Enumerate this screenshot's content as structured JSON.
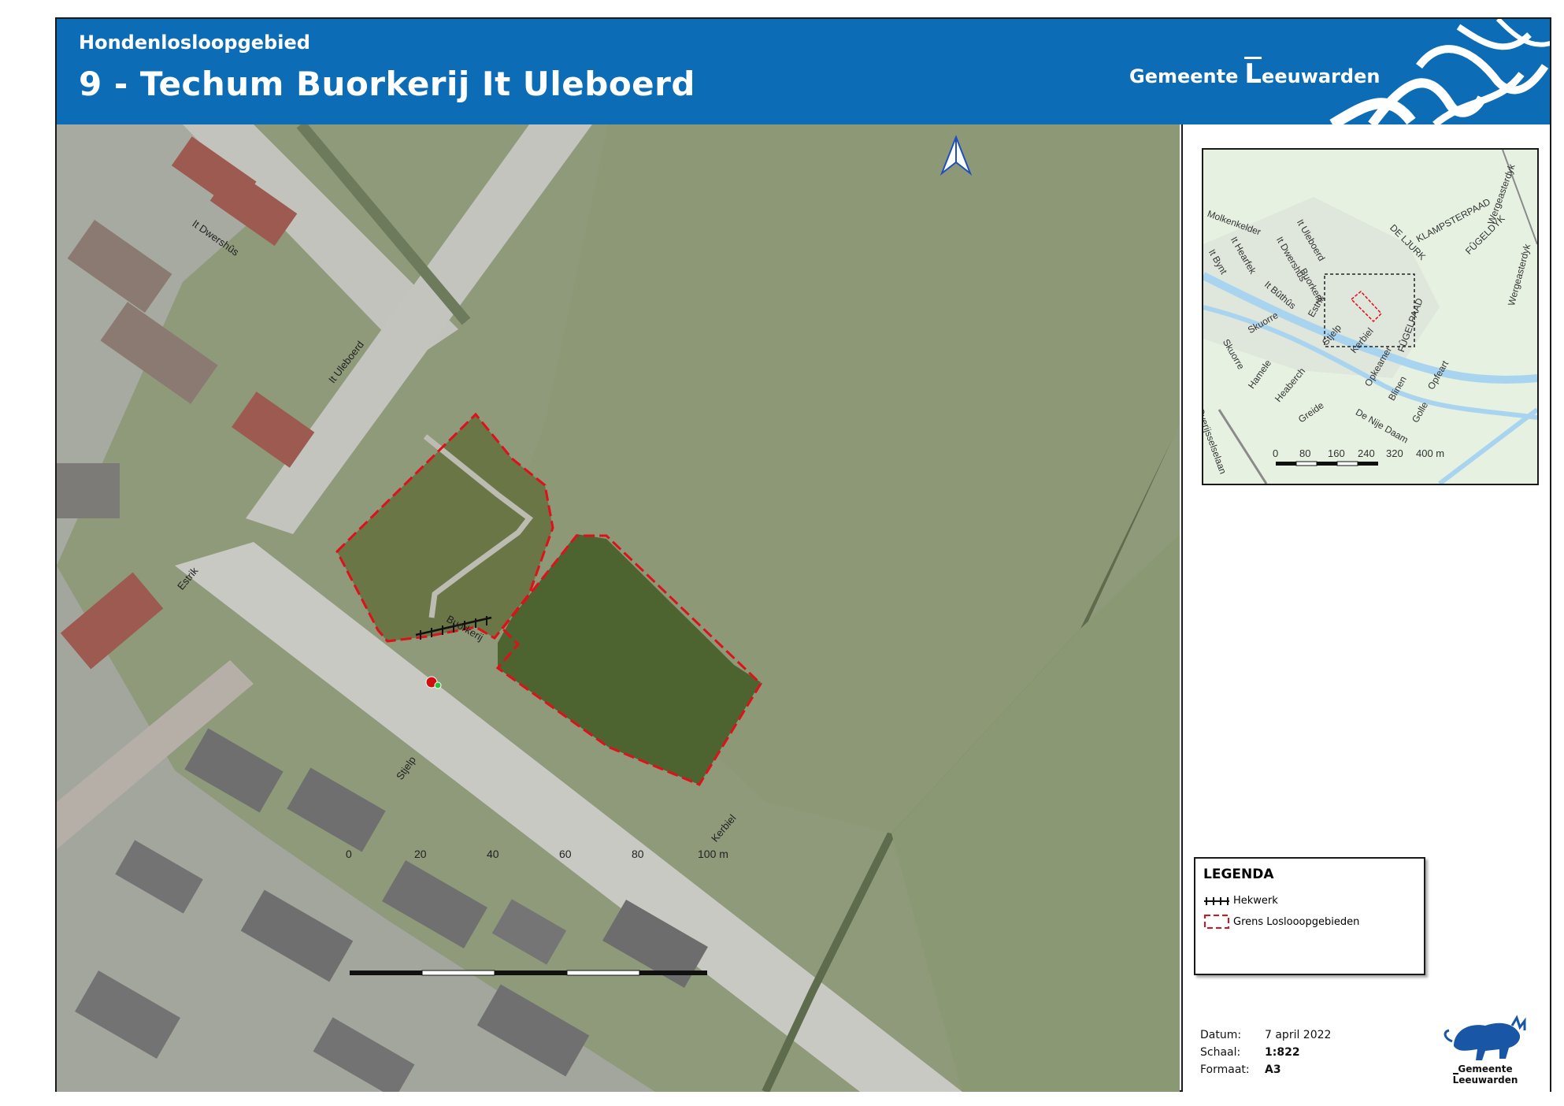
{
  "header": {
    "subtitle": "Hondenlosloopgebied",
    "title": "9 - Techum Buorkerij It Uleboerd",
    "logo_text_left": "Gemeente",
    "logo_text_L": "L",
    "logo_text_right": "eeuwarden"
  },
  "map": {
    "street_labels": [
      "It Dwershûs",
      "It Uleboerd",
      "Estrik",
      "Buorkerij",
      "Stjelp",
      "Kerbiel"
    ],
    "scalebar": {
      "ticks": [
        "0",
        "20",
        "40",
        "60",
        "80",
        "100 m"
      ]
    },
    "north_arrow": "north-arrow-icon",
    "colors": {
      "boundary": "#e0101a",
      "fence": "#111111",
      "grass_area": "#5f6f3a"
    }
  },
  "inset": {
    "labels": [
      "Molkenkelder",
      "It Hearfek",
      "It Dwershûs",
      "It Uleboerd",
      "Buorkerij",
      "It Bynt",
      "It Bûthûs",
      "Estrik",
      "DE LJURK",
      "KLAMPSTERPAAD",
      "FÛGELDYK",
      "Wergeasterdyk",
      "Wergeasterdyk",
      "Skuorre",
      "Skuorre",
      "Stjelp",
      "Kerbiel",
      "FÛGELPAAD",
      "Hamele",
      "Heaberch",
      "Opkeamer",
      "Blinen",
      "Opfeart",
      "Greide",
      "De Nije Daam",
      "Golle",
      "Overijsselselaan"
    ],
    "scale_ticks": [
      "0",
      "80",
      "160",
      "240",
      "320",
      "400 m"
    ]
  },
  "legend": {
    "title": "LEGENDA",
    "items": [
      {
        "label": "Hekwerk",
        "symbol": "fence"
      },
      {
        "label": "Grens Loslooopgebieden",
        "symbol": "boundary"
      }
    ]
  },
  "meta": {
    "datum_label": "Datum:",
    "datum_value": "7 april 2022",
    "schaal_label": "Schaal:",
    "schaal_value": "1:822",
    "formaat_label": "Formaat:",
    "formaat_value": "A3"
  },
  "footer_logo": {
    "text_left": "Gemeente",
    "text_L": "L",
    "text_right": "eeuwarden"
  }
}
